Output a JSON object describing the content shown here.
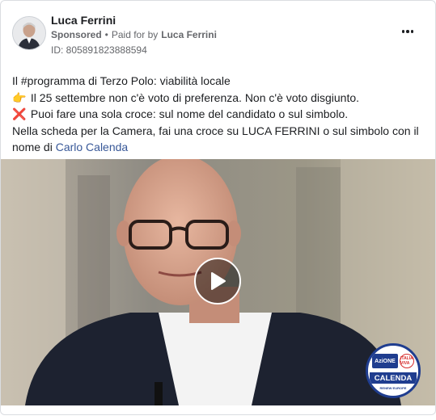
{
  "post": {
    "author": "Luca Ferrini",
    "sponsored_label": "Sponsored",
    "separator": "•",
    "paid_for_text": "Paid for by",
    "payer": "Luca Ferrini",
    "ad_id": "ID: 805891823888594",
    "more_icon": "more-horizontal-icon"
  },
  "body": {
    "line1": "Il #programma di Terzo Polo: viabilità locale",
    "line2_emoji": "👉",
    "line2": "Il 25 settembre non c'è voto di preferenza. Non c'è voto disgiunto.",
    "line3_emoji": "❌",
    "line3": "Puoi fare una sola croce: sul nome del candidato o sul simbolo.",
    "line4": "Nella scheda per la Camera, fai una croce su LUCA FERRINI o sul simbolo con il nome di",
    "line4_link": "Carlo Calenda"
  },
  "video": {
    "play_icon": "play-icon",
    "logo": {
      "azione": "AziONE",
      "italia_viva": "ITALIA VIVA",
      "name": "CALENDA",
      "subtitle": "RENEW EUROPE"
    }
  },
  "colors": {
    "link": "#385898",
    "secondary_text": "#65676b",
    "logo_blue": "#1f3d8f"
  }
}
